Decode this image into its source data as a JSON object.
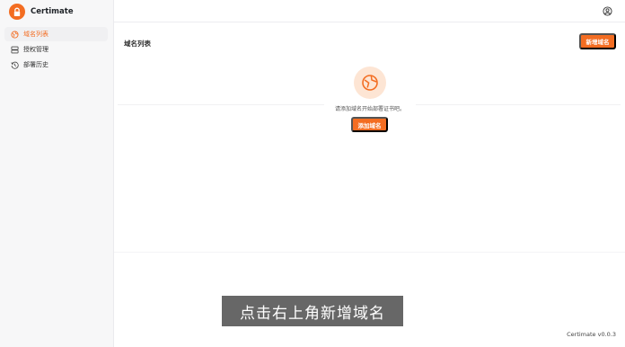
{
  "brand": {
    "name": "Certimate",
    "accent": "#f36d22"
  },
  "sidebar": {
    "items": [
      {
        "label": "域名列表",
        "icon": "globe-icon",
        "active": true
      },
      {
        "label": "授权管理",
        "icon": "server-icon",
        "active": false
      },
      {
        "label": "部署历史",
        "icon": "history-icon",
        "active": false
      }
    ]
  },
  "header": {
    "user_icon": "user-circle-icon"
  },
  "main": {
    "title": "域名列表",
    "new_button": "新增域名",
    "empty": {
      "icon": "globe-icon",
      "message": "请添加域名开始部署证书吧。",
      "add_button": "添加域名"
    }
  },
  "overlay": {
    "subtitle": "点击右上角新增域名"
  },
  "footer": {
    "version": "Certimate v0.0.3"
  }
}
